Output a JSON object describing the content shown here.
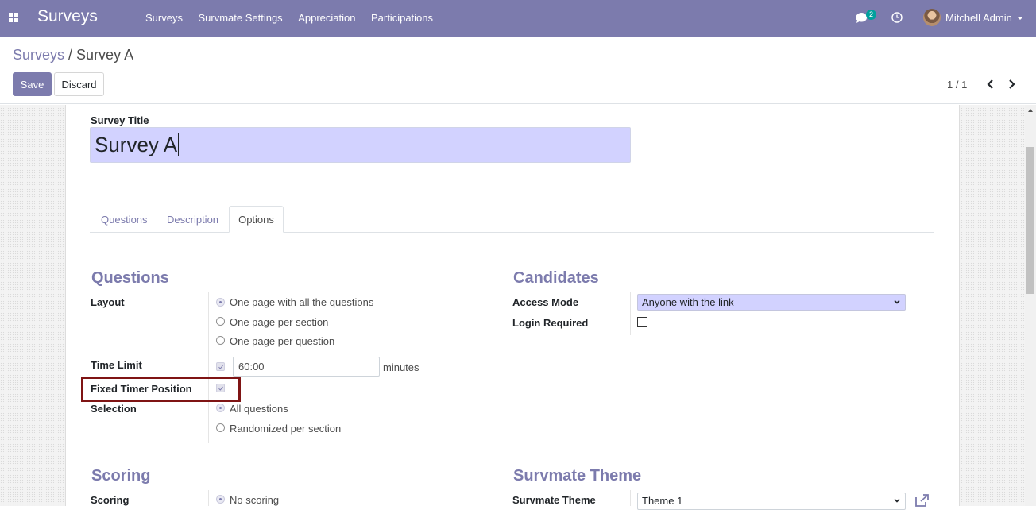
{
  "navbar": {
    "app_name": "Surveys",
    "menu": [
      "Surveys",
      "Survmate Settings",
      "Appreciation",
      "Participations"
    ],
    "chat_count": "2",
    "user_name": "Mitchell Admin",
    "icons": [
      "apps-grid-icon",
      "chat-icon",
      "clock-icon",
      "chevron-down-icon"
    ],
    "color": "#7c7bad"
  },
  "breadcrumb": {
    "parent": "Surveys",
    "separator": " / ",
    "current": "Survey A"
  },
  "buttons": {
    "save": "Save",
    "discard": "Discard"
  },
  "pager": {
    "value": "1 / 1"
  },
  "form": {
    "title_label": "Survey Title",
    "title_value": "Survey A",
    "tabs": [
      "Questions",
      "Description",
      "Options"
    ],
    "active_tab": "Options",
    "questions_group": {
      "title": "Questions",
      "layout_label": "Layout",
      "layout_options": [
        "One page with all the questions",
        "One page per section",
        "One page per question"
      ],
      "layout_selected": "One page with all the questions",
      "time_limit_label": "Time Limit",
      "time_limit_checked": true,
      "time_limit_value": "60:00",
      "time_limit_unit": "minutes",
      "fixed_timer_label": "Fixed Timer Position",
      "fixed_timer_checked": true,
      "selection_label": "Selection",
      "selection_options": [
        "All questions",
        "Randomized per section"
      ],
      "selection_selected": "All questions"
    },
    "candidates_group": {
      "title": "Candidates",
      "access_mode_label": "Access Mode",
      "access_mode_value": "Anyone with the link",
      "login_required_label": "Login Required",
      "login_required_checked": false
    },
    "scoring_group": {
      "title": "Scoring",
      "scoring_label": "Scoring",
      "scoring_value": "No scoring"
    },
    "theme_group": {
      "title": "Survmate Theme",
      "theme_label": "Survmate Theme",
      "theme_value": "Theme 1"
    }
  }
}
